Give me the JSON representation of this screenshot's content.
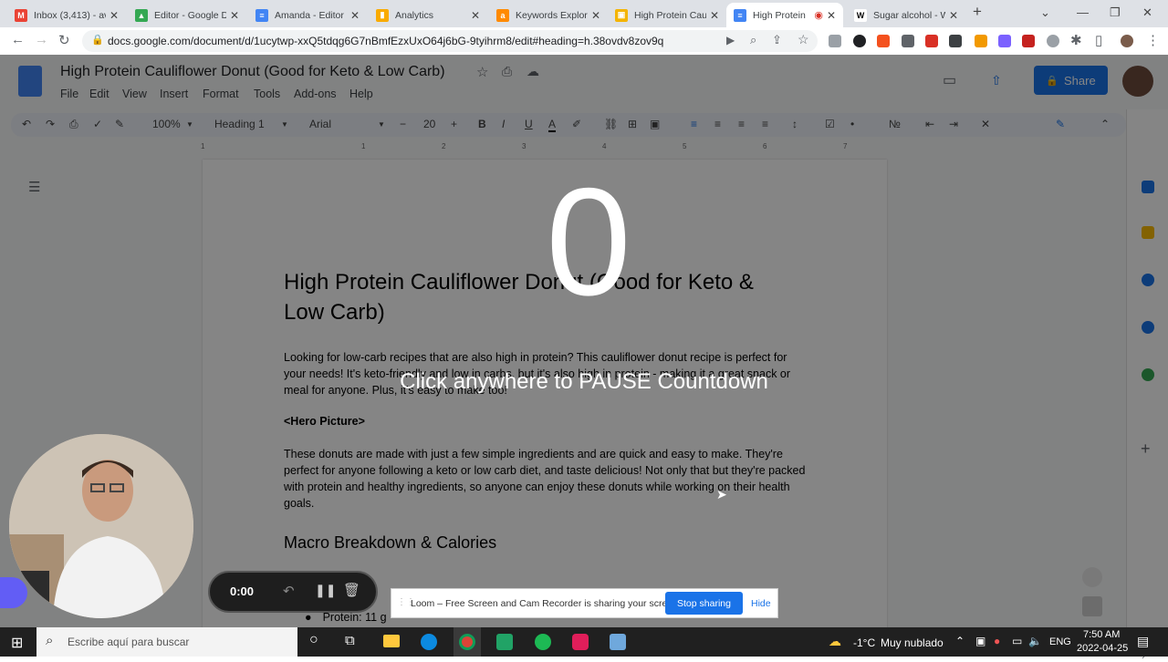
{
  "tabs": [
    {
      "label": "Inbox (3,413) - av",
      "fav": "#ea4335",
      "fl": "M"
    },
    {
      "label": "Editor - Google D",
      "fav": "#34a853",
      "fl": "▲"
    },
    {
      "label": "Amanda - Editor",
      "fav": "#4285f4",
      "fl": "≡"
    },
    {
      "label": "Analytics",
      "fav": "#f9ab00",
      "fl": "▮"
    },
    {
      "label": "Keywords Explore",
      "fav": "#ff8a00",
      "fl": "a"
    },
    {
      "label": "High Protein Cau",
      "fav": "#f4b400",
      "fl": "▣"
    },
    {
      "label": "High Protein",
      "fav": "#4285f4",
      "fl": "≡"
    },
    {
      "label": "Sugar alcohol - W",
      "fav": "#ffffff",
      "fl": "W"
    }
  ],
  "browser": {
    "url": "docs.google.com/document/d/1ucytwp-xxQ5tdqg6G7nBmfEzxUxO64j6bG-9tyihrm8/edit#heading=h.38ovdv8zov9q",
    "new_tab": "+"
  },
  "docs": {
    "title": "High Protein Cauliflower Donut (Good for Keto & Low Carb)",
    "menu": [
      "File",
      "Edit",
      "View",
      "Insert",
      "Format",
      "Tools",
      "Add-ons",
      "Help"
    ],
    "share_label": "Share",
    "toolbar": {
      "zoom": "100%",
      "style": "Heading 1",
      "font": "Arial",
      "size": "20"
    },
    "ruler_numbers": [
      "1",
      "1",
      "2",
      "3",
      "4",
      "5",
      "6",
      "7"
    ],
    "heading": "High Protein Cauliflower Donut (Good for Keto & Low Carb)",
    "para1": "Looking for low-carb recipes that are also high in protein? This cauliflower donut recipe is perfect for your needs! It's keto-friendly and low in carbs, but it's also high in protein - making it a great snack or meal for anyone. Plus, it's easy to make too!",
    "hero": "<Hero Picture>",
    "para2": "These donuts are made with just a few simple ingredients and are quick and easy to make. They're perfect for anyone following a keto or low carb diet, and taste delicious! Not only that but they're packed with protein and healthy ingredients, so anyone can enjoy these donuts while working on their health goals.",
    "section2": "Macro Breakdown & Calories",
    "list_item": "Protein: 11 g"
  },
  "overlay": {
    "countdown": "0",
    "hint": "Click anywhere to PAUSE Countdown"
  },
  "loom": {
    "timer": "0:00",
    "share_message": "Loom – Free Screen and Cam Recorder is sharing your screen.",
    "stop_label": "Stop sharing",
    "hide_label": "Hide"
  },
  "taskbar": {
    "search_placeholder": "Escribe aquí para buscar",
    "weather_temp": "-1°C",
    "weather_text": "Muy nublado",
    "lang": "ENG",
    "time": "7:50 AM",
    "date": "2022-04-25"
  },
  "colors": {
    "docs_blue": "#1a73e8",
    "stop_blue": "#1a73e8",
    "dim": "rgba(0,0,0,0.48)"
  }
}
